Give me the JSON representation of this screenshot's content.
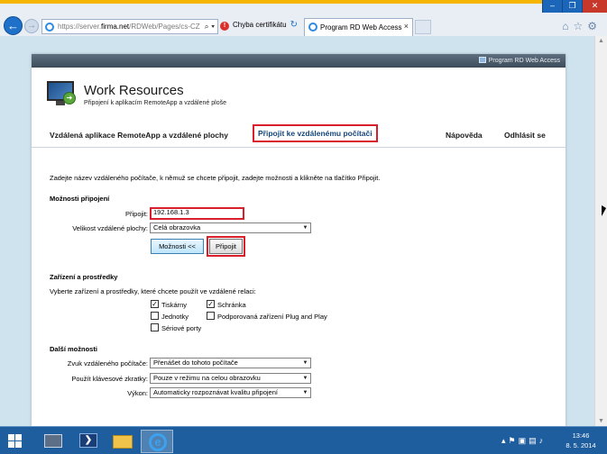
{
  "browser": {
    "address_url_gray": "https://server.",
    "address_url_domain": "firma.net",
    "address_url_path": "/RDWeb/Pages/cs-CZ",
    "address_tools": "⌕ ▾",
    "cert_error": "Chyba certifikátu",
    "tab_title": "Program RD Web Access",
    "tab_close": "×",
    "nav_back": "←",
    "nav_fwd": "→",
    "reload": "↻",
    "window_min": "–",
    "window_restore": "❐",
    "window_close": "✕",
    "toolbar_icons": "⌂☆⚙"
  },
  "header": {
    "strip_label": "Program RD Web Access",
    "title": "Work Resources",
    "subtitle": "Připojení k aplikacím RemoteApp a vzdálené ploše"
  },
  "nav": {
    "remoteapp": "Vzdálená aplikace RemoteApp a vzdálené plochy",
    "connect": "Připojit ke vzdálenému počítači",
    "help": "Nápověda",
    "signout": "Odhlásit se"
  },
  "intro": "Zadejte název vzdáleného počítače, k němuž se chcete připojit, zadejte možnosti a klikněte na tlačítko Připojit.",
  "connection": {
    "heading": "Možnosti připojení",
    "connect_label": "Připojit:",
    "connect_value": "192.168.1.3",
    "size_label": "Velikost vzdálené plochy:",
    "size_value": "Celá obrazovka",
    "options_button": "Možnosti <<",
    "connect_button": "Připojit"
  },
  "devices": {
    "heading": "Zařízení a prostředky",
    "description": "Vyberte zařízení a prostředky, které chcete použít ve vzdálené relaci:",
    "items": [
      {
        "label": "Tiskárny",
        "checked": true
      },
      {
        "label": "Schránka",
        "checked": true
      },
      {
        "label": "Jednotky",
        "checked": false
      },
      {
        "label": "Podporovaná zařízení Plug and Play",
        "checked": false
      },
      {
        "label": "Sériové porty",
        "checked": false
      }
    ]
  },
  "more": {
    "heading": "Další možnosti",
    "sound_label": "Zvuk vzdáleného počítače:",
    "sound_value": "Přenášet do tohoto počítače",
    "keys_label": "Použít klávesové zkratky:",
    "keys_value": "Pouze v režimu na celou obrazovku",
    "perf_label": "Výkon:",
    "perf_value": "Automaticky rozpoznávat kvalitu připojení"
  },
  "taskbar": {
    "powershell_glyph": "❯",
    "ie_glyph": "e",
    "tray_icons": "▴⚑▣▤♪",
    "time": "13:46",
    "date": "8. 5. 2014"
  },
  "colors": {
    "highlight": "#d81f2b",
    "page_bg": "#cfe3ee",
    "taskbar": "#1f5e9e"
  }
}
